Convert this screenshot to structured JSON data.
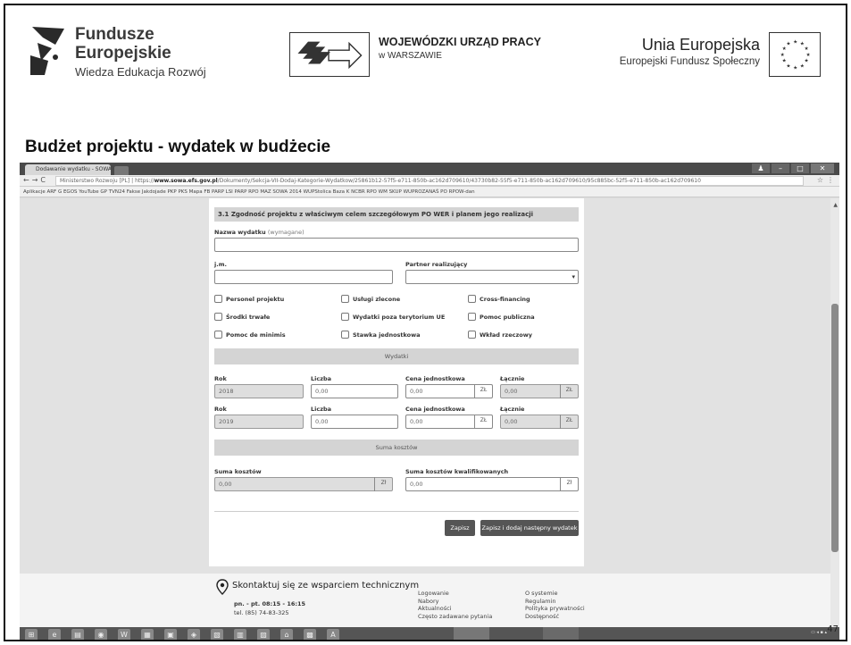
{
  "header": {
    "fe_line1": "Fundusze",
    "fe_line2": "Europejskie",
    "fe_line3": "Wiedza Edukacja Rozwój",
    "wup_line1": "WOJEWÓDZKI URZĄD PRACY",
    "wup_line2": "w WARSZAWIE",
    "ue_line1": "Unia Europejska",
    "ue_line2": "Europejski Fundusz Społeczny"
  },
  "slide": {
    "title": "Budżet projektu  - wydatek w budżecie",
    "page_number": "47"
  },
  "browser": {
    "tab_title": "Dodawanie wydatku - SOWA",
    "url_prefix": "Ministerstwo Rozwoju [PL] | https://",
    "url_host": "www.sowa.efs.gov.pl",
    "url_path": "/Dokumenty/Sekcja-VII-Dodaj-Kategorie-Wydatkow/25861b12-57f5-e711-850b-ac162d709610/43730b82-55f5-e711-850b-ac162d709610/95c885bc-52f5-e711-850b-ac162d709610",
    "bookmarks": "Aplikacje   ARF   G   EGOS   YouTube   GP   TVN24   Fakse   Jakdojade   PKP   PKS   Mapa   FB   PARP   LSI PARP   RPO MAZ   SOWA 2014   WUPStolica   Baza K   NCBR   RPO WM   SKUP   WUPROZANAŚ   PO   RPOW-dan"
  },
  "form": {
    "section_title": "3.1 Zgodność projektu z właściwym celem szczegółowym PO WER i planem jego realizacji",
    "nazwa_label": "Nazwa wydatku",
    "nazwa_required": "(wymagane)",
    "jm_label": "j.m.",
    "partner_label": "Partner realizujący",
    "checkboxes": [
      "Personel projektu",
      "Usługi zlecone",
      "Cross-financing",
      "Środki trwałe",
      "Wydatki poza terytorium UE",
      "Pomoc publiczna",
      "Pomoc de minimis",
      "Stawka jednostkowa",
      "Wkład rzeczowy"
    ],
    "wydatki_band": "Wydatki",
    "rows": [
      {
        "rok_label": "Rok",
        "liczba_label": "Liczba",
        "cena_label": "Cena jednostkowa",
        "lacznie_label": "Łącznie",
        "rok": "2018",
        "liczba": "0,00",
        "cena": "0,00",
        "lacznie": "0,00",
        "unit": "ZŁ"
      },
      {
        "rok_label": "Rok",
        "liczba_label": "Liczba",
        "cena_label": "Cena jednostkowa",
        "lacznie_label": "Łącznie",
        "rok": "2019",
        "liczba": "0,00",
        "cena": "0,00",
        "lacznie": "0,00",
        "unit": "ZŁ"
      }
    ],
    "suma_band": "Suma kosztów",
    "suma_label": "Suma kosztów",
    "suma_kwal_label": "Suma kosztów kwalifikowanych",
    "suma_value": "0,00",
    "suma_kwal_value": "0,00",
    "suma_unit": "Zł",
    "btn_save": "Zapisz",
    "btn_save_next": "Zapisz i dodaj następny wydatek"
  },
  "footer": {
    "contact_title": "Skontaktuj się ze wsparciem technicznym",
    "hours": "pn. - pt. 08:15 - 16:15",
    "phone": "tel. (85) 74-83-325",
    "links_col1": [
      "Logowanie",
      "Nabory",
      "Aktualności",
      "Często zadawane pytania"
    ],
    "links_col2": [
      "O systemie",
      "Regulamin",
      "Polityka prywatności",
      "Dostępność"
    ]
  },
  "colors": {
    "accent": "#555555",
    "field_readonly": "#dedede",
    "band": "#d4d4d4"
  }
}
